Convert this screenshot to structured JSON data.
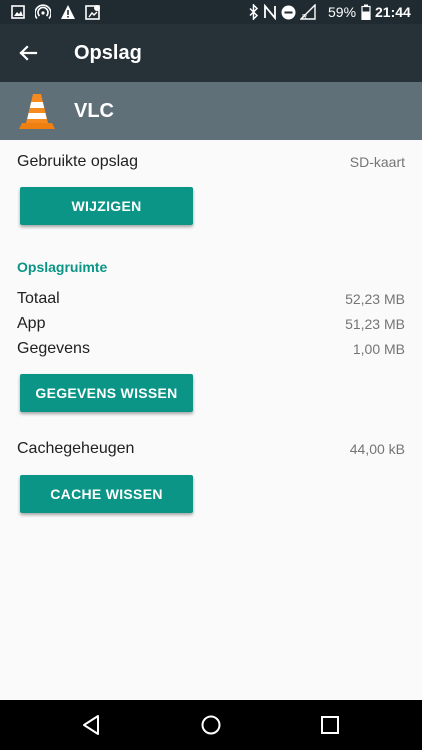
{
  "status_bar": {
    "battery": "59%",
    "time": "21:44",
    "icons": [
      "image-icon",
      "hotspot-icon",
      "warning-icon",
      "location-icon",
      "bluetooth-icon",
      "nfc-icon",
      "dnd-icon",
      "signal-icon",
      "battery-icon"
    ]
  },
  "app_bar": {
    "title": "Opslag"
  },
  "app_header": {
    "name": "VLC"
  },
  "used_storage": {
    "label": "Gebruikte opslag",
    "value": "SD-kaart",
    "button": "WIJZIGEN"
  },
  "storage_space": {
    "heading": "Opslagruimte",
    "rows": [
      {
        "label": "Totaal",
        "value": "52,23 MB"
      },
      {
        "label": "App",
        "value": "51,23 MB"
      },
      {
        "label": "Gegevens",
        "value": "1,00 MB"
      }
    ],
    "button": "GEGEVENS WISSEN"
  },
  "cache": {
    "label": "Cachegeheugen",
    "value": "44,00 kB",
    "button": "CACHE WISSEN"
  },
  "colors": {
    "accent": "#0a9586",
    "appbar": "#263238",
    "header": "#607078"
  }
}
